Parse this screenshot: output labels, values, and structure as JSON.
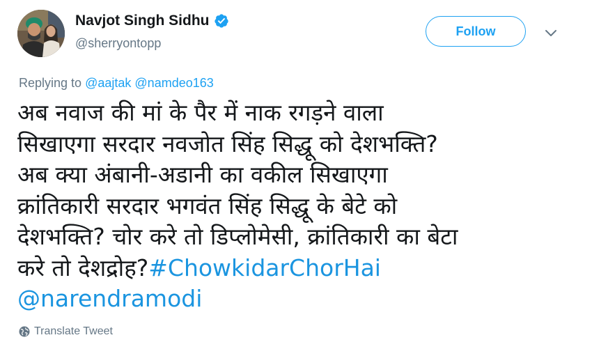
{
  "author": {
    "display_name": "Navjot Singh Sidhu",
    "handle": "@sherryontopp",
    "verified": true,
    "avatar_icon": "profile-photo"
  },
  "follow_button": {
    "label": "Follow"
  },
  "menu": {
    "icon": "chevron-down-icon"
  },
  "reply": {
    "prefix": "Replying to",
    "mentions": [
      "@aajtak",
      "@namdeo163"
    ]
  },
  "tweet": {
    "lines": [
      "अब नवाज की मां के पैर में नाक रगड़ने वाला",
      "सिखाएगा सरदार नवजोत सिंह सिद्धू को देशभक्ति?",
      "अब क्या अंबानी-अडानी का वकील सिखाएगा",
      "क्रांतिकारी सरदार भगवंत सिंह सिद्धू के बेटे को",
      "देशभक्ति? चोर करे तो डिप्लोमेसी, क्रांतिकारी का बेटा"
    ],
    "last_line_text": "करे तो देशद्रोह?",
    "hashtag": "#ChowkidarChorHai",
    "mention": "@narendramodi"
  },
  "translate": {
    "label": "Translate Tweet",
    "icon": "globe-icon"
  },
  "colors": {
    "accent": "#1da1f2",
    "link": "#1b95e0",
    "secondary_text": "#657786",
    "primary_text": "#14171a"
  }
}
